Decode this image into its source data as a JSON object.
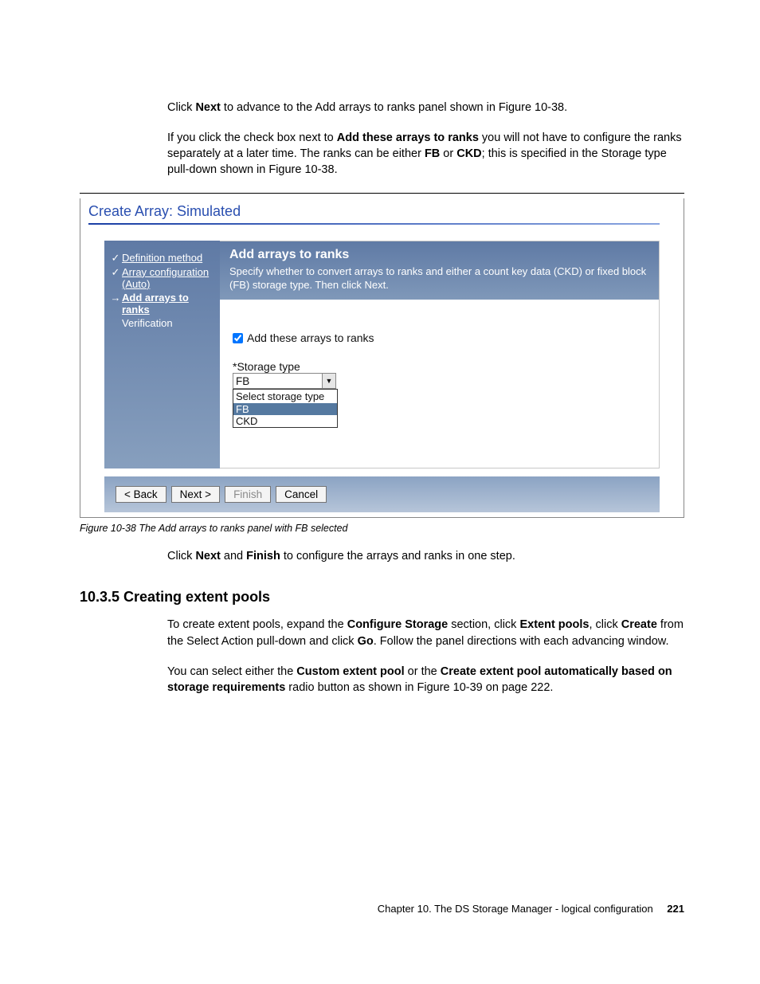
{
  "para1": {
    "a": "Click ",
    "b": "Next",
    "c": " to advance to the Add arrays to ranks panel shown in Figure 10-38."
  },
  "para2": {
    "a": "If you click the check box next to ",
    "b": "Add these arrays to ranks",
    "c": " you will not have to configure the ranks separately at a later time. The ranks can be either ",
    "d": "FB",
    "e": " or ",
    "f": "CKD",
    "g": "; this is specified in the Storage type pull-down shown in Figure 10-38."
  },
  "wizard": {
    "title": "Create Array: Simulated",
    "side": {
      "i0": "Definition method",
      "i1": "Array configuration (Auto)",
      "i2": "Add arrays to ranks",
      "i3": "Verification"
    },
    "head": {
      "title": "Add arrays to ranks",
      "desc": "Specify whether to convert arrays to ranks and either a count key data (CKD) or fixed block (FB) storage type. Then click Next."
    },
    "content": {
      "checkbox": "Add these arrays to ranks",
      "stlabel": "*Storage type",
      "selected": "FB",
      "listhdr": "Select storage type",
      "opt0": "FB",
      "opt1": "CKD"
    },
    "buttons": {
      "back": "< Back",
      "next": "Next >",
      "finish": "Finish",
      "cancel": "Cancel"
    }
  },
  "caption": "Figure 10-38   The Add arrays to ranks panel with FB selected",
  "para3": {
    "a": "Click ",
    "b": "Next",
    "c": " and ",
    "d": "Finish",
    "e": " to configure the arrays and ranks in one step."
  },
  "section": "10.3.5  Creating extent pools",
  "para4": {
    "a": "To create extent pools, expand the ",
    "b": "Configure Storage",
    "c": " section, click ",
    "d": "Extent pools",
    "e": ", click ",
    "f": "Create",
    "g": " from the Select Action pull-down and click ",
    "h": "Go",
    "i": ". Follow the panel directions with each advancing window."
  },
  "para5": {
    "a": "You can select either the ",
    "b": "Custom extent pool",
    "c": " or the ",
    "d": "Create extent pool automatically based on storage requirements",
    "e": " radio button as shown in Figure 10-39 on page 222."
  },
  "footer": {
    "chapter": "Chapter 10. The DS Storage Manager - logical configuration",
    "page": "221"
  }
}
